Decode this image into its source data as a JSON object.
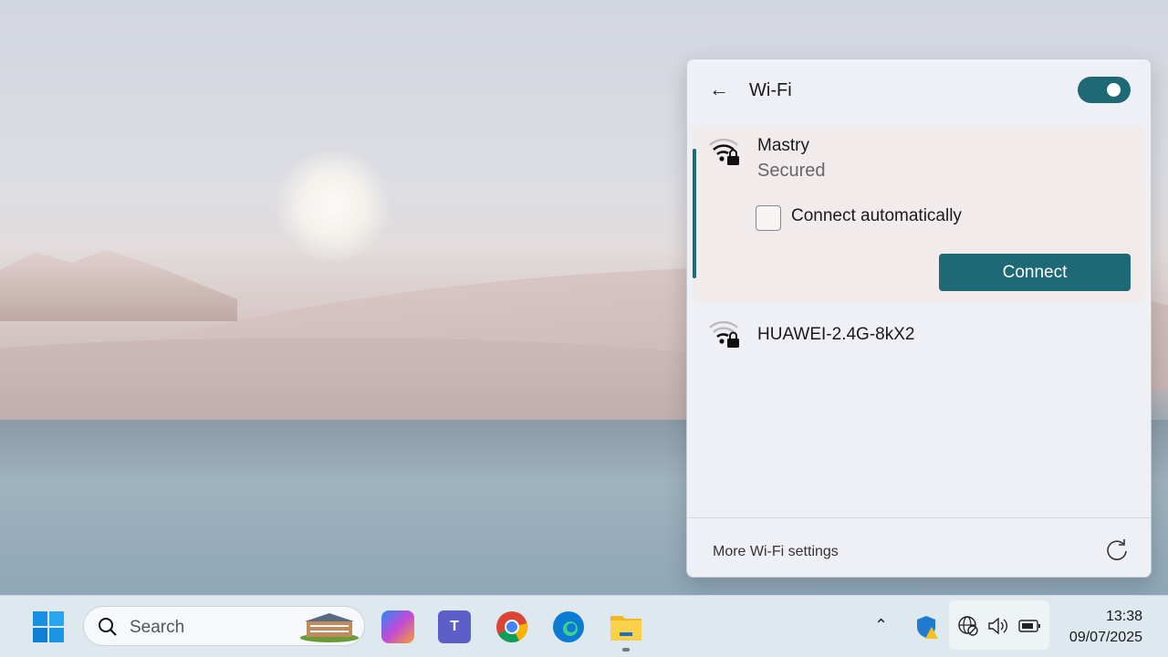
{
  "wifi_panel": {
    "title": "Wi-Fi",
    "wifi_enabled": true,
    "networks": [
      {
        "name": "Mastry",
        "status": "Secured",
        "connect_automatically": false,
        "connect_label": "Connect",
        "auto_label": "Connect automatically"
      },
      {
        "name": "HUAWEI-2.4G-8kX2"
      }
    ],
    "more_settings": "More Wi-Fi settings"
  },
  "taskbar": {
    "search_placeholder": "Search",
    "apps": [
      "start",
      "copilot",
      "teams",
      "chrome",
      "edge",
      "file-explorer"
    ],
    "time": "13:38",
    "date": "09/07/2025"
  },
  "colors": {
    "accent": "#1e6976"
  }
}
